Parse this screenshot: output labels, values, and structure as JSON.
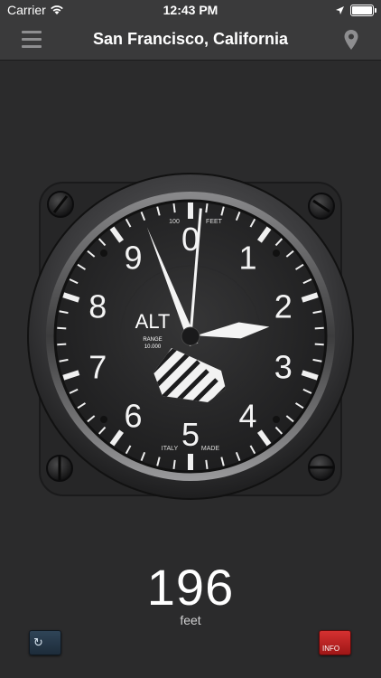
{
  "status_bar": {
    "carrier": "Carrier",
    "time": "12:43 PM"
  },
  "nav": {
    "title": "San Francisco, California",
    "menu_icon": "hamburger-menu-icon",
    "location_icon": "map-pin-icon"
  },
  "gauge": {
    "center_label": "ALT",
    "range_label": "RANGE",
    "range_value": "10.000",
    "scale_top_left": "100",
    "scale_top_right": "FEET",
    "maker_left": "ITALY",
    "maker_right": "MADE",
    "dial_numbers": [
      "0",
      "1",
      "2",
      "3",
      "4",
      "5",
      "6",
      "7",
      "8",
      "9"
    ],
    "reading_feet": 196
  },
  "reading": {
    "value": "196",
    "unit": "feet"
  },
  "buttons": {
    "refresh_glyph": "↻",
    "info_label": "INFO"
  },
  "colors": {
    "bar_bg": "#3a3a3b",
    "page_bg": "#2b2b2c",
    "info_red": "#c62828",
    "refresh_blue": "#2a3d50"
  }
}
